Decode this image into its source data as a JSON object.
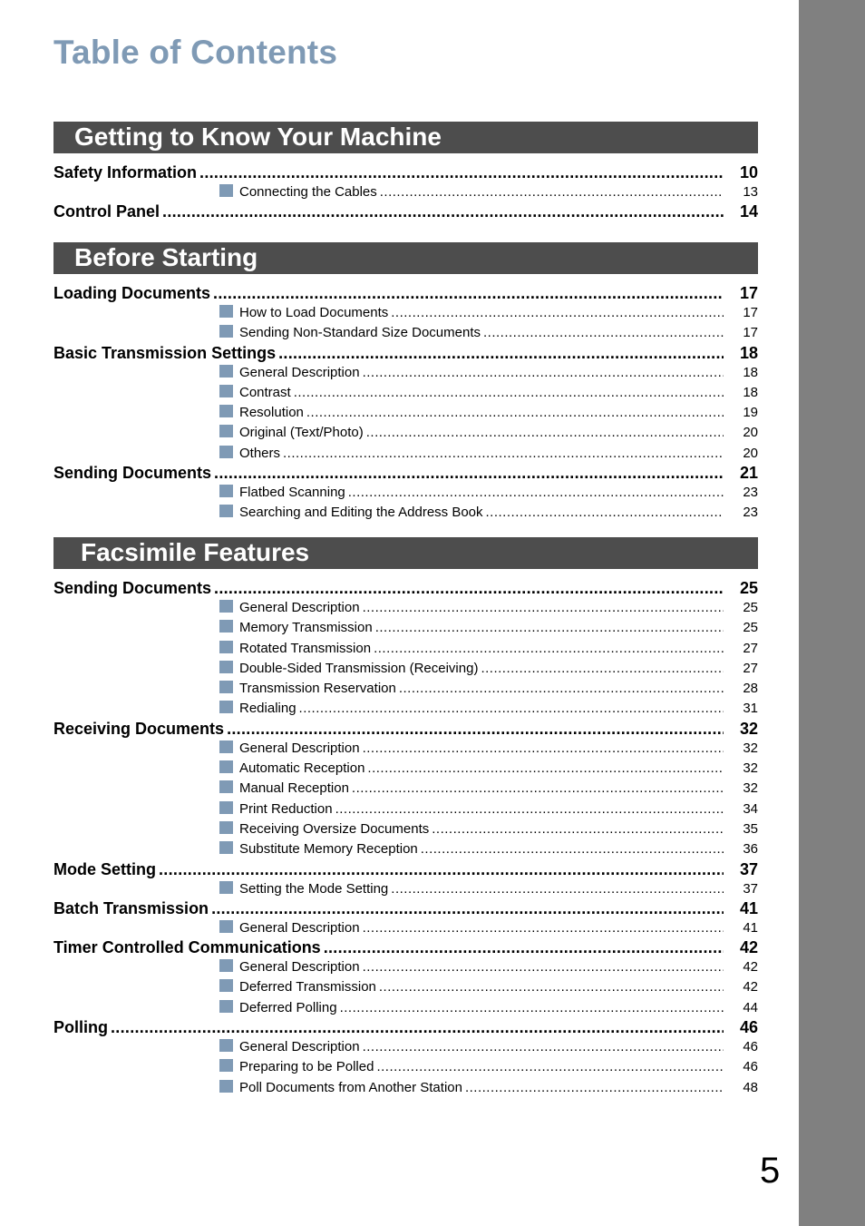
{
  "title": "Table of Contents",
  "page_number": "5",
  "colors": {
    "title": "#7f9ab5",
    "bullet": "#7f9ab5",
    "section_bg": "#4d4d4d",
    "side_bar": "#808080"
  },
  "sections": [
    {
      "heading": "Getting to Know Your Machine",
      "entries": [
        {
          "type": "main",
          "label": "Safety Information",
          "page": "10"
        },
        {
          "type": "sub",
          "label": "Connecting the Cables",
          "page": "13"
        },
        {
          "type": "main",
          "label": "Control Panel",
          "page": "14"
        }
      ]
    },
    {
      "heading": "Before Starting",
      "entries": [
        {
          "type": "main",
          "label": "Loading Documents",
          "page": "17"
        },
        {
          "type": "sub",
          "label": "How to Load Documents",
          "page": "17"
        },
        {
          "type": "sub",
          "label": "Sending Non-Standard Size Documents",
          "page": "17"
        },
        {
          "type": "main",
          "label": "Basic Transmission Settings",
          "page": "18"
        },
        {
          "type": "sub",
          "label": "General Description",
          "page": "18"
        },
        {
          "type": "sub",
          "label": "Contrast",
          "page": "18"
        },
        {
          "type": "sub",
          "label": "Resolution",
          "page": "19"
        },
        {
          "type": "sub",
          "label": "Original (Text/Photo)",
          "page": "20"
        },
        {
          "type": "sub",
          "label": "Others",
          "page": "20"
        },
        {
          "type": "main",
          "label": "Sending Documents",
          "page": "21"
        },
        {
          "type": "sub",
          "label": "Flatbed Scanning",
          "page": "23"
        },
        {
          "type": "sub",
          "label": "Searching and Editing the Address Book",
          "page": "23"
        }
      ]
    },
    {
      "heading": "Facsimile Features",
      "entries": [
        {
          "type": "main",
          "label": "Sending Documents",
          "page": "25"
        },
        {
          "type": "sub",
          "label": "General Description",
          "page": "25"
        },
        {
          "type": "sub",
          "label": "Memory Transmission",
          "page": "25"
        },
        {
          "type": "sub",
          "label": "Rotated Transmission",
          "page": "27"
        },
        {
          "type": "sub",
          "label": "Double-Sided Transmission (Receiving)",
          "page": "27"
        },
        {
          "type": "sub",
          "label": "Transmission Reservation",
          "page": "28"
        },
        {
          "type": "sub",
          "label": "Redialing",
          "page": "31"
        },
        {
          "type": "main",
          "label": "Receiving Documents",
          "page": "32"
        },
        {
          "type": "sub",
          "label": "General Description",
          "page": "32"
        },
        {
          "type": "sub",
          "label": "Automatic Reception",
          "page": "32"
        },
        {
          "type": "sub",
          "label": "Manual Reception",
          "page": "32"
        },
        {
          "type": "sub",
          "label": "Print Reduction",
          "page": "34"
        },
        {
          "type": "sub",
          "label": "Receiving Oversize Documents",
          "page": "35"
        },
        {
          "type": "sub",
          "label": "Substitute Memory Reception",
          "page": "36"
        },
        {
          "type": "main",
          "label": "Mode Setting",
          "page": "37"
        },
        {
          "type": "sub",
          "label": "Setting the Mode Setting",
          "page": "37"
        },
        {
          "type": "main",
          "label": "Batch Transmission",
          "page": "41"
        },
        {
          "type": "sub",
          "label": "General Description",
          "page": "41"
        },
        {
          "type": "main",
          "label": "Timer Controlled Communications",
          "page": "42"
        },
        {
          "type": "sub",
          "label": "General Description",
          "page": "42"
        },
        {
          "type": "sub",
          "label": "Deferred Transmission",
          "page": "42"
        },
        {
          "type": "sub",
          "label": "Deferred Polling",
          "page": "44"
        },
        {
          "type": "main",
          "label": "Polling",
          "page": "46"
        },
        {
          "type": "sub",
          "label": "General Description",
          "page": "46"
        },
        {
          "type": "sub",
          "label": "Preparing to be Polled",
          "page": "46"
        },
        {
          "type": "sub",
          "label": "Poll Documents from Another Station",
          "page": "48"
        }
      ]
    }
  ]
}
